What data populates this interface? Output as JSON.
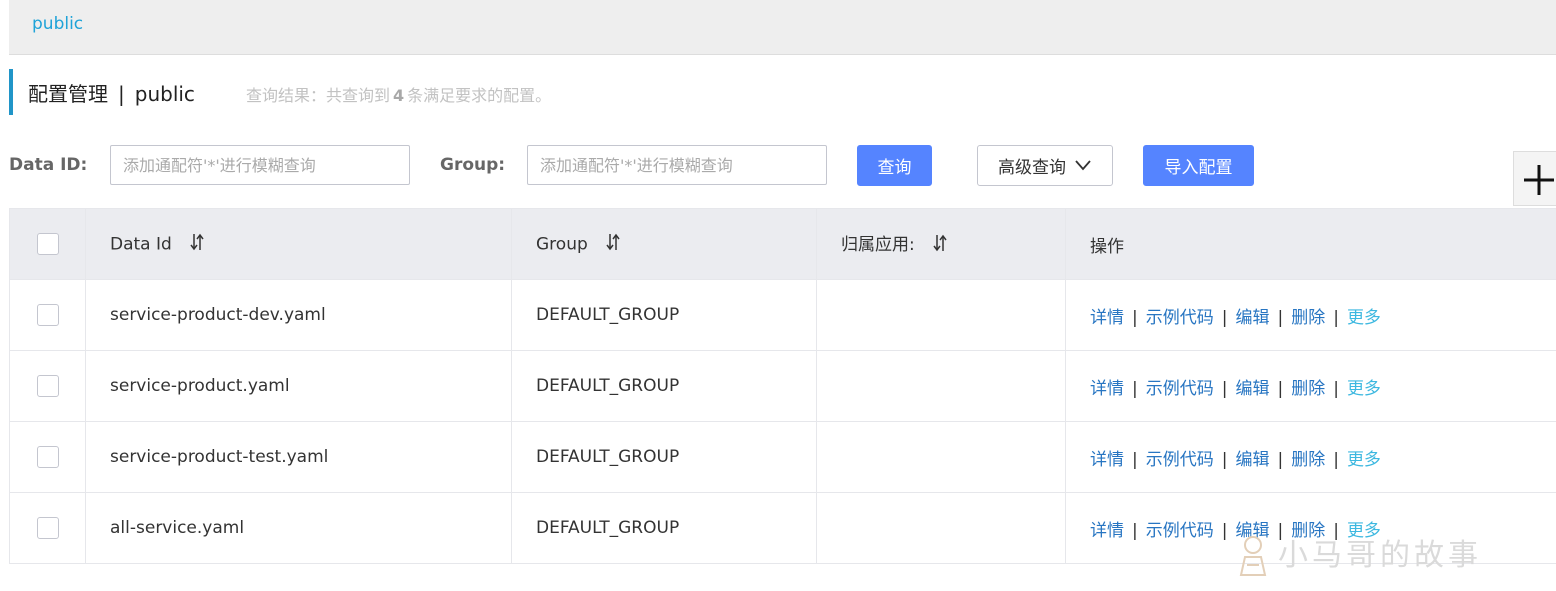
{
  "namespace_tab": {
    "label": "public"
  },
  "header": {
    "title": "配置管理",
    "separator": "|",
    "namespace": "public",
    "query_result_prefix": "查询结果：共查询到",
    "query_result_count": "4",
    "query_result_suffix": "条满足要求的配置。"
  },
  "search": {
    "data_id_label": "Data ID:",
    "data_id_placeholder": "添加通配符'*'进行模糊查询",
    "data_id_value": "",
    "group_label": "Group:",
    "group_placeholder": "添加通配符'*'进行模糊查询",
    "group_value": "",
    "query_button": "查询",
    "advanced_query_button": "高级查询",
    "import_button": "导入配置"
  },
  "table": {
    "columns": [
      "Data Id",
      "Group",
      "归属应用:",
      "操作"
    ],
    "rows": [
      {
        "data_id": "service-product-dev.yaml",
        "group": "DEFAULT_GROUP",
        "app": ""
      },
      {
        "data_id": "service-product.yaml",
        "group": "DEFAULT_GROUP",
        "app": ""
      },
      {
        "data_id": "service-product-test.yaml",
        "group": "DEFAULT_GROUP",
        "app": ""
      },
      {
        "data_id": "all-service.yaml",
        "group": "DEFAULT_GROUP",
        "app": ""
      }
    ],
    "actions": {
      "detail": "详情",
      "sample_code": "示例代码",
      "edit": "编辑",
      "delete": "删除",
      "more": "更多",
      "separator": "|"
    }
  },
  "watermark": {
    "text": "小马哥的故事"
  },
  "colors": {
    "primary_button": "#5584ff",
    "link": "#2775c2",
    "more_link": "#3db8e0",
    "namespace_tab": "#1fa3d8",
    "title_accent": "#2095c8",
    "table_header_bg": "#ebecf0"
  },
  "icons": {
    "sort": "sort-arrows-icon",
    "dropdown": "chevron-down-icon",
    "add": "plus-icon",
    "checkbox": "checkbox-icon",
    "watermark_logo": "person-logo-icon"
  }
}
